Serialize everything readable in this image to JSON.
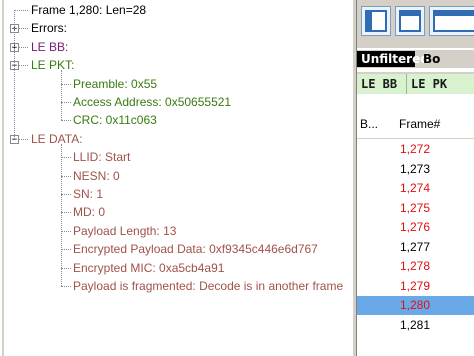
{
  "tree": [
    {
      "key": "frame",
      "label": "Frame 1,280:  Len=28",
      "color": "#000000",
      "level": 0,
      "expander": "none"
    },
    {
      "key": "errors",
      "label": "Errors:",
      "color": "#000000",
      "level": 0,
      "expander": "+"
    },
    {
      "key": "le_bb",
      "label": "LE BB:",
      "color": "#7a1a7a",
      "level": 0,
      "expander": "+"
    },
    {
      "key": "le_pkt",
      "label": "LE PKT:",
      "color": "#3a7a12",
      "level": 0,
      "expander": "-"
    },
    {
      "key": "preamble",
      "label": "Preamble: 0x55",
      "color": "#3a7a12",
      "level": 1,
      "expander": "none"
    },
    {
      "key": "access_address",
      "label": "Access Address: 0x50655521",
      "color": "#3a7a12",
      "level": 1,
      "expander": "none"
    },
    {
      "key": "crc",
      "label": "CRC: 0x11c063",
      "color": "#3a7a12",
      "level": 1,
      "expander": "none"
    },
    {
      "key": "le_data",
      "label": "LE DATA:",
      "color": "#a0524a",
      "level": 0,
      "expander": "-"
    },
    {
      "key": "llid",
      "label": "LLID: Start",
      "color": "#a0524a",
      "level": 1,
      "expander": "none"
    },
    {
      "key": "nesn",
      "label": "NESN: 0",
      "color": "#a0524a",
      "level": 1,
      "expander": "none"
    },
    {
      "key": "sn",
      "label": "SN: 1",
      "color": "#a0524a",
      "level": 1,
      "expander": "none"
    },
    {
      "key": "md",
      "label": "MD: 0",
      "color": "#a0524a",
      "level": 1,
      "expander": "none"
    },
    {
      "key": "payload_length",
      "label": "Payload Length: 13",
      "color": "#a0524a",
      "level": 1,
      "expander": "none"
    },
    {
      "key": "encrypted_payload",
      "label": "Encrypted Payload Data: 0xf9345c446e6d767",
      "color": "#a0524a",
      "level": 1,
      "expander": "none"
    },
    {
      "key": "encrypted_mic",
      "label": "Encrypted MIC: 0xa5cb4a91",
      "color": "#a0524a",
      "level": 1,
      "expander": "none"
    },
    {
      "key": "fragmented",
      "label": "Payload is fragmented: Decode is in another frame",
      "color": "#a0524a",
      "level": 1,
      "expander": "none"
    }
  ],
  "toolbar": {
    "buttons": [
      {
        "name": "layout-tree-icon"
      },
      {
        "name": "layout-header-icon"
      },
      {
        "name": "layout-list-icon"
      }
    ]
  },
  "tabs_row1": [
    {
      "label": "Unfiltered",
      "active": true
    },
    {
      "label": "Bo",
      "active": false
    }
  ],
  "tabs_row2": [
    {
      "label": "LE BB"
    },
    {
      "label": "LE PK"
    }
  ],
  "frame_list": {
    "columns": [
      "B...",
      "Frame#"
    ],
    "rows": [
      {
        "frame": "1,272",
        "color": "#e01010",
        "selected": false
      },
      {
        "frame": "1,273",
        "color": "#000000",
        "selected": false
      },
      {
        "frame": "1,274",
        "color": "#e01010",
        "selected": false
      },
      {
        "frame": "1,275",
        "color": "#e01010",
        "selected": false
      },
      {
        "frame": "1,276",
        "color": "#e01010",
        "selected": false
      },
      {
        "frame": "1,277",
        "color": "#000000",
        "selected": false
      },
      {
        "frame": "1,278",
        "color": "#e01010",
        "selected": false
      },
      {
        "frame": "1,279",
        "color": "#e01010",
        "selected": false
      },
      {
        "frame": "1,280",
        "color": "#e01010",
        "selected": true
      },
      {
        "frame": "1,281",
        "color": "#000000",
        "selected": false
      }
    ]
  },
  "colors": {
    "selection": "#6aa9e8",
    "tab_active_bg": "#000000",
    "tab_green_bg": "#d8f2cf"
  }
}
